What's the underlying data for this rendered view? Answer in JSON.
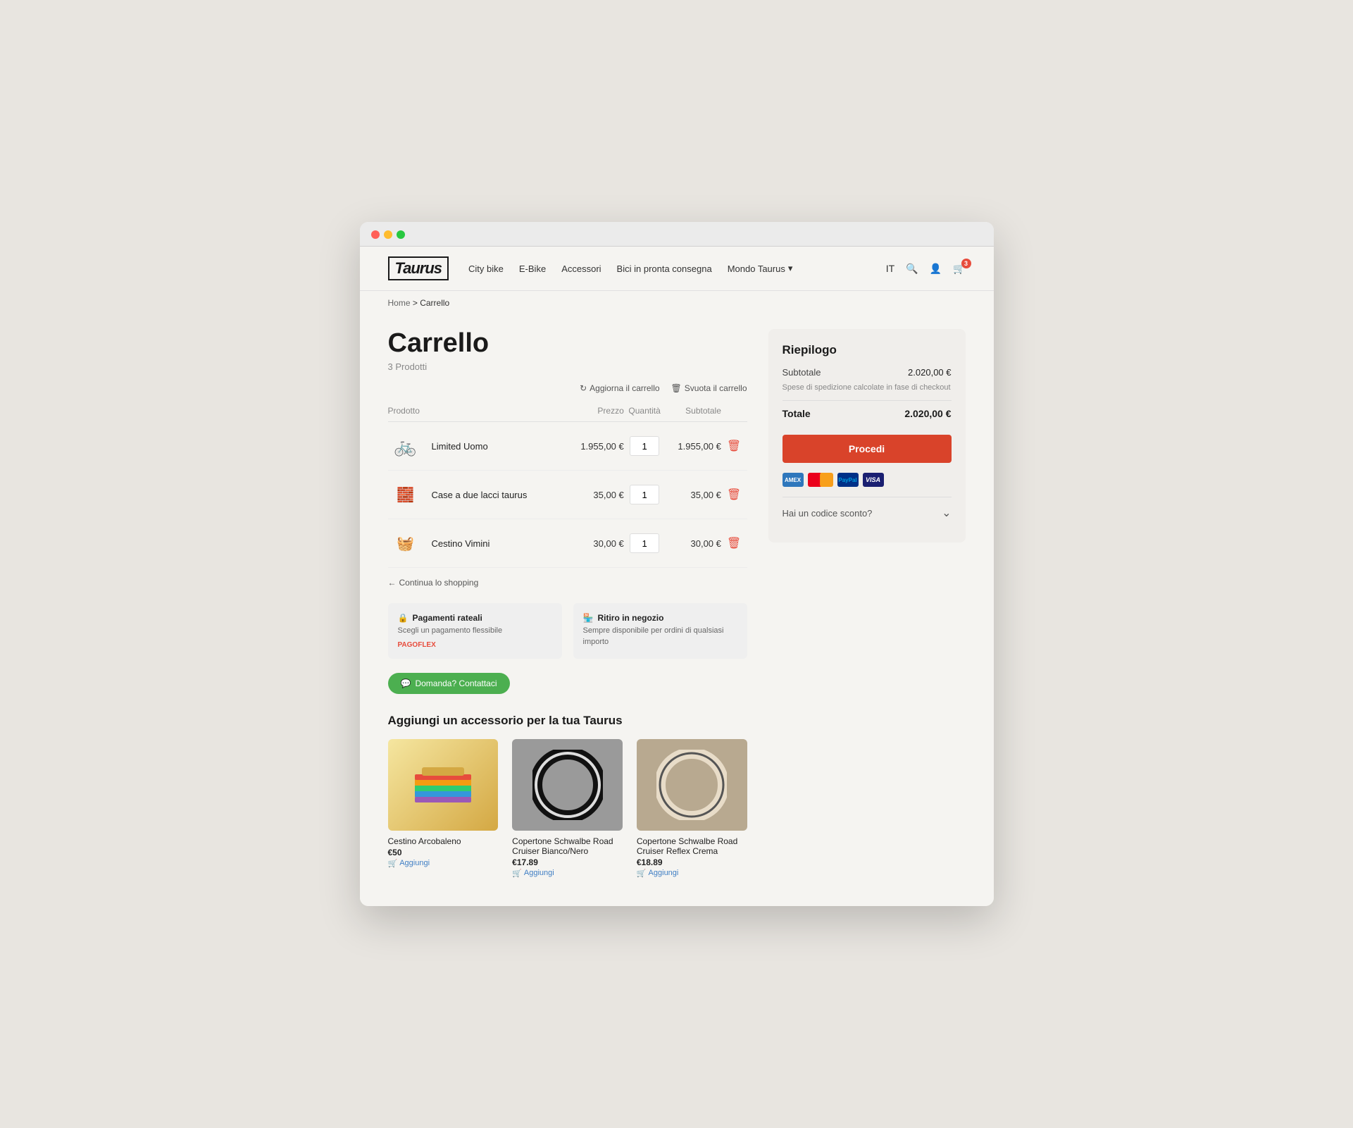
{
  "browser": {
    "dots": [
      "red",
      "yellow",
      "green"
    ]
  },
  "header": {
    "logo": "Taurus",
    "nav": [
      {
        "label": "City bike",
        "id": "city-bike"
      },
      {
        "label": "E-Bike",
        "id": "e-bike"
      },
      {
        "label": "Accessori",
        "id": "accessori"
      },
      {
        "label": "Bici in pronta consegna",
        "id": "bici-pronta"
      },
      {
        "label": "Mondo Taurus",
        "id": "mondo-taurus",
        "hasChevron": true
      }
    ],
    "lang": "IT",
    "cart_count": "3"
  },
  "breadcrumb": {
    "home": "Home",
    "separator": ">",
    "current": "Carrello"
  },
  "cart": {
    "title": "Carrello",
    "subtitle": "3 Prodotti",
    "actions": {
      "refresh": "Aggiorna il carrello",
      "clear": "Svuota il carrello"
    },
    "table": {
      "headers": {
        "product": "Prodotto",
        "price": "Prezzo",
        "quantity": "Quantità",
        "subtotal": "Subtotale"
      },
      "rows": [
        {
          "name": "Limited Uomo",
          "price": "1.955,00 €",
          "qty": "1",
          "subtotal": "1.955,00 €",
          "icon": "🚲"
        },
        {
          "name": "Case a due lacci taurus",
          "price": "35,00 €",
          "qty": "1",
          "subtotal": "35,00 €",
          "icon": "🧱"
        },
        {
          "name": "Cestino Vimini",
          "price": "30,00 €",
          "qty": "1",
          "subtotal": "30,00 €",
          "icon": "🧺"
        }
      ]
    },
    "continue_shopping": "Continua lo shopping",
    "info_boxes": [
      {
        "icon": "🔒",
        "title": "Pagamenti rateali",
        "desc": "Scegli un pagamento flessibile",
        "logo": "PAGOFLEX"
      },
      {
        "icon": "🏪",
        "title": "Ritiro in negozio",
        "desc": "Sempre disponibile per ordini di qualsiasi importo"
      }
    ],
    "contact_btn": "Domanda? Contattaci",
    "accessories_title": "Aggiungi un accessorio per la tua Taurus",
    "accessories": [
      {
        "name": "Cestino Arcobaleno",
        "price": "€50",
        "add_label": "Aggiungi",
        "color": "rainbow"
      },
      {
        "name": "Copertone Schwalbe Road Cruiser Bianco/Nero",
        "price": "€17.89",
        "add_label": "Aggiungi",
        "color": "black"
      },
      {
        "name": "Copertone Schwalbe Road Cruiser Reflex Crema",
        "price": "€18.89",
        "add_label": "Aggiungi",
        "color": "cream"
      }
    ]
  },
  "summary": {
    "title": "Riepilogo",
    "subtotal_label": "Subtotale",
    "subtotal_value": "2.020,00 €",
    "shipping_note": "Spese di spedizione calcolate in fase di checkout",
    "total_label": "Totale",
    "total_value": "2.020,00 €",
    "procedi_label": "Procedi",
    "discount_label": "Hai un codice sconto?",
    "payment_methods": [
      "AMEX",
      "MC",
      "PayPal",
      "VISA"
    ]
  }
}
